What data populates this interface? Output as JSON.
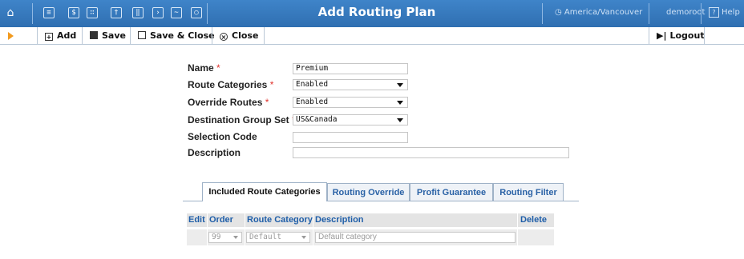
{
  "header": {
    "title": "Add Routing Plan",
    "timezone": "America/Vancouver",
    "user": "demoroot",
    "help_label": "Help",
    "nav_icons": [
      "home-icon",
      "list-icon",
      "dollar-icon",
      "grid-icon",
      "person-icon",
      "columns-icon",
      "forward-icon",
      "chart-icon",
      "search-icon"
    ]
  },
  "toolbar": {
    "add_label": "Add",
    "save_label": "Save",
    "save_close_label": "Save & Close",
    "close_label": "Close",
    "logout_label": "Logout"
  },
  "form": {
    "name": {
      "label": "Name",
      "value": "Premium",
      "required": true
    },
    "route_categories": {
      "label": "Route Categories",
      "value": "Enabled",
      "required": true
    },
    "override_routes": {
      "label": "Override Routes",
      "value": "Enabled",
      "required": true
    },
    "destination_group_set": {
      "label": "Destination Group Set",
      "value": "US&Canada",
      "required": true
    },
    "selection_code": {
      "label": "Selection Code",
      "value": ""
    },
    "description": {
      "label": "Description",
      "value": ""
    },
    "required_mark": "*"
  },
  "tabs": [
    {
      "label": "Included Route Categories",
      "active": true
    },
    {
      "label": "Routing Override",
      "active": false
    },
    {
      "label": "Profit Guarantee",
      "active": false
    },
    {
      "label": "Routing Filter",
      "active": false
    }
  ],
  "table": {
    "headers": [
      "Edit",
      "Order",
      "Route Category",
      "Description",
      "Delete"
    ],
    "rows": [
      {
        "order": "99",
        "route_category": "Default",
        "description": "Default category"
      }
    ]
  },
  "colors": {
    "header_bg": "#3a7dc2",
    "link": "#2a62a6",
    "required": "#e0332d",
    "toolbar_arrow": "#f29a1e"
  }
}
